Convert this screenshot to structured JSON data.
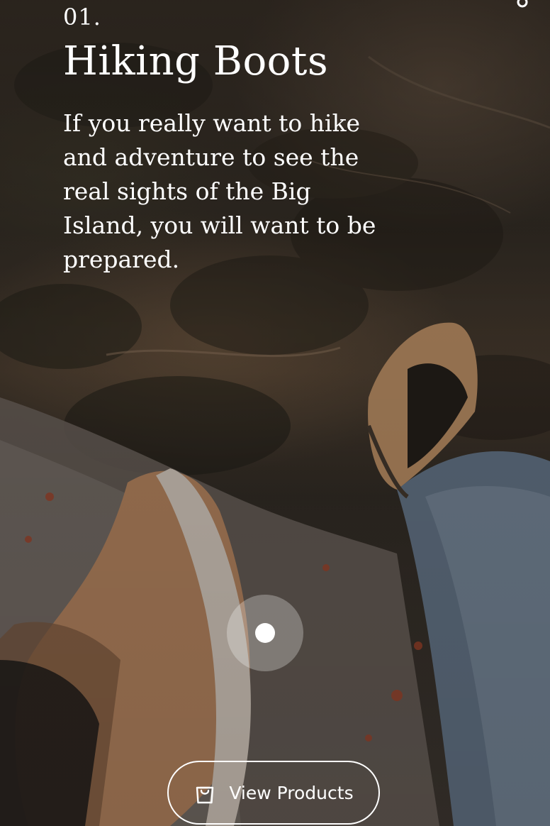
{
  "slide": {
    "index": "01.",
    "title": "Hiking Boots",
    "description": "If you really want to hike and adventure to see the real sights of the Big Island, you will want to be prepared."
  },
  "cta": {
    "label": "View Products",
    "icon": "shopping-bag-icon"
  },
  "hotspot": {
    "icon": "hotspot-dot-icon"
  },
  "colors": {
    "text": "#ffffff",
    "hotspot_ring": "rgba(255,255,255,0.28)"
  }
}
